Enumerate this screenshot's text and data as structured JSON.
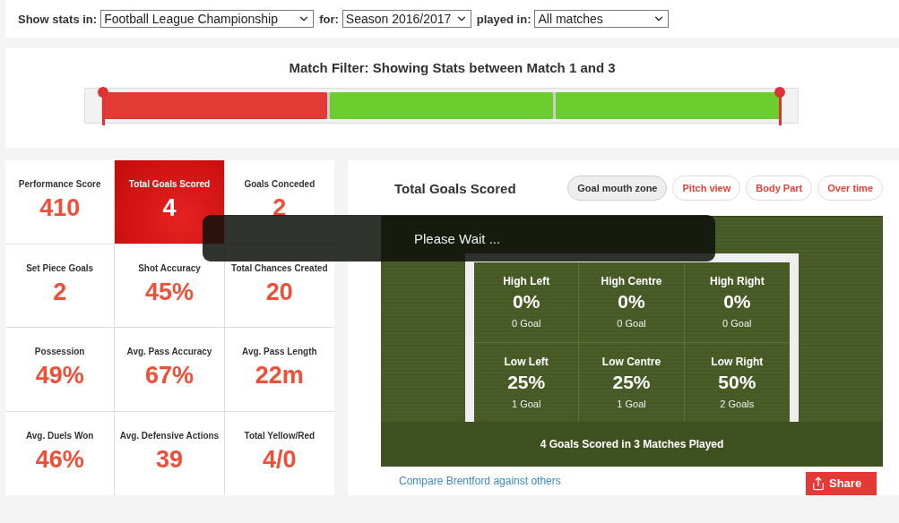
{
  "filters": [
    {
      "label": "Show stats in:",
      "value": "Football League Championship"
    },
    {
      "label": "for:",
      "value": "Season 2016/2017"
    },
    {
      "label": "played in:",
      "value": "All matches"
    }
  ],
  "match_filter": {
    "title": "Match Filter: Showing Stats between Match 1 and 3",
    "matches": [
      {
        "color": "#e23b36"
      },
      {
        "color": "#6ccd2e"
      },
      {
        "color": "#6ccd2e"
      }
    ],
    "handles": [
      {
        "level": 0
      },
      {
        "level": 1
      }
    ]
  },
  "stats": [
    {
      "label": "Performance Score",
      "value": "410",
      "selected": false
    },
    {
      "label": "Total Goals Scored",
      "value": "4",
      "selected": true
    },
    {
      "label": "Goals Conceded",
      "value": "2",
      "selected": false
    },
    {
      "label": "Set Piece Goals",
      "value": "2",
      "selected": false
    },
    {
      "label": "Shot Accuracy",
      "value": "45%",
      "selected": false
    },
    {
      "label": "Total Chances Created",
      "value": "20",
      "selected": false
    },
    {
      "label": "Possession",
      "value": "49%",
      "selected": false
    },
    {
      "label": "Avg. Pass Accuracy",
      "value": "67%",
      "selected": false
    },
    {
      "label": "Avg. Pass Length",
      "value": "22m",
      "selected": false
    },
    {
      "label": "Avg. Duels Won",
      "value": "46%",
      "selected": false
    },
    {
      "label": "Avg. Defensive Actions",
      "value": "39",
      "selected": false
    },
    {
      "label": "Total Yellow/Red",
      "value": "4/0",
      "selected": false
    }
  ],
  "detail": {
    "title": "Total Goals Scored",
    "tabs": [
      {
        "label": "Goal mouth zone",
        "selected": true
      },
      {
        "label": "Pitch view",
        "selected": false
      },
      {
        "label": "Body Part",
        "selected": false
      },
      {
        "label": "Over time",
        "selected": false
      }
    ],
    "zones": [
      {
        "name": "High Left",
        "percent": "0%",
        "goals": "0 Goal"
      },
      {
        "name": "High Centre",
        "percent": "0%",
        "goals": "0 Goal"
      },
      {
        "name": "High Right",
        "percent": "0%",
        "goals": "0 Goal"
      },
      {
        "name": "Low Left",
        "percent": "25%",
        "goals": "1 Goal"
      },
      {
        "name": "Low Centre",
        "percent": "25%",
        "goals": "1 Goal"
      },
      {
        "name": "Low Right",
        "percent": "50%",
        "goals": "2 Goals"
      }
    ],
    "summary": "4 Goals Scored in 3 Matches Played",
    "compare_link": "Compare Brentford against others",
    "share_button": "Share"
  },
  "loading": {
    "text": "Please Wait ..."
  }
}
